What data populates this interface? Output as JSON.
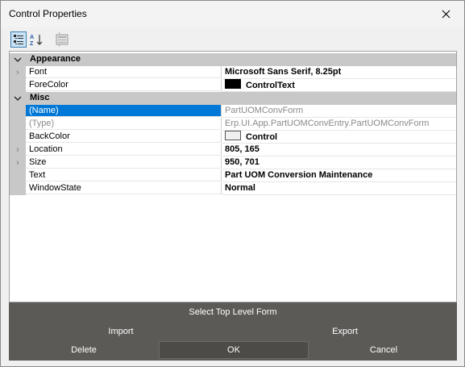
{
  "window": {
    "title": "Control Properties"
  },
  "toolbar": {
    "categorized_icon": "categorized-icon",
    "alphabetical_icon": "alphabetical-icon",
    "property_pages_icon": "property-pages-icon"
  },
  "grid": {
    "categories": [
      {
        "label": "Appearance"
      },
      {
        "label": "Misc"
      }
    ],
    "appearance": [
      {
        "name": "Font",
        "value": "Microsoft Sans Serif, 8.25pt",
        "expandable": true
      },
      {
        "name": "ForeColor",
        "value": "ControlText",
        "swatch": "#000000"
      }
    ],
    "misc": [
      {
        "name": "(Name)",
        "value": "PartUOMConvForm",
        "selected": true
      },
      {
        "name": "(Type)",
        "value": "Erp.UI.App.PartUOMConvEntry.PartUOMConvForm",
        "readonly": true
      },
      {
        "name": "BackColor",
        "value": "Control",
        "swatch": "#f0f0f0"
      },
      {
        "name": "Location",
        "value": "805, 165",
        "expandable": true
      },
      {
        "name": "Size",
        "value": "950, 701",
        "expandable": true
      },
      {
        "name": "Text",
        "value": "Part UOM Conversion Maintenance"
      },
      {
        "name": "WindowState",
        "value": "Normal"
      }
    ]
  },
  "buttons": {
    "select_top_level": "Select Top Level Form",
    "import": "Import",
    "export": "Export",
    "delete": "Delete",
    "ok": "OK",
    "cancel": "Cancel"
  },
  "colors": {
    "selection": "#0078d7",
    "category_bg": "#c8c8c8",
    "footer_bg": "#5c5a56"
  }
}
